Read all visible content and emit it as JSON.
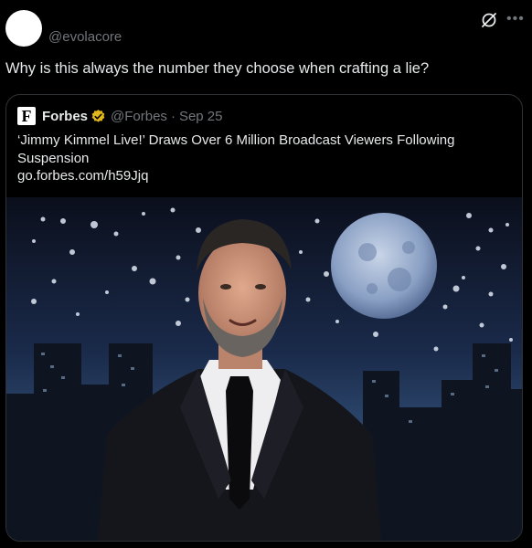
{
  "tweet": {
    "handle": "@evolacore",
    "text": "Why is this always the number they choose when crafting a lie?",
    "more_icon": "more-icon",
    "grok_icon": "grok-icon"
  },
  "quote": {
    "logo_letter": "F",
    "name": "Forbes",
    "handle": "@Forbes",
    "separator": "·",
    "date": "Sep 25",
    "headline": "‘Jimmy Kimmel Live!’ Draws Over 6 Million Broadcast Viewers Following Suspension",
    "link": "go.forbes.com/h59Jjq",
    "verified_color": "#e2b719"
  }
}
